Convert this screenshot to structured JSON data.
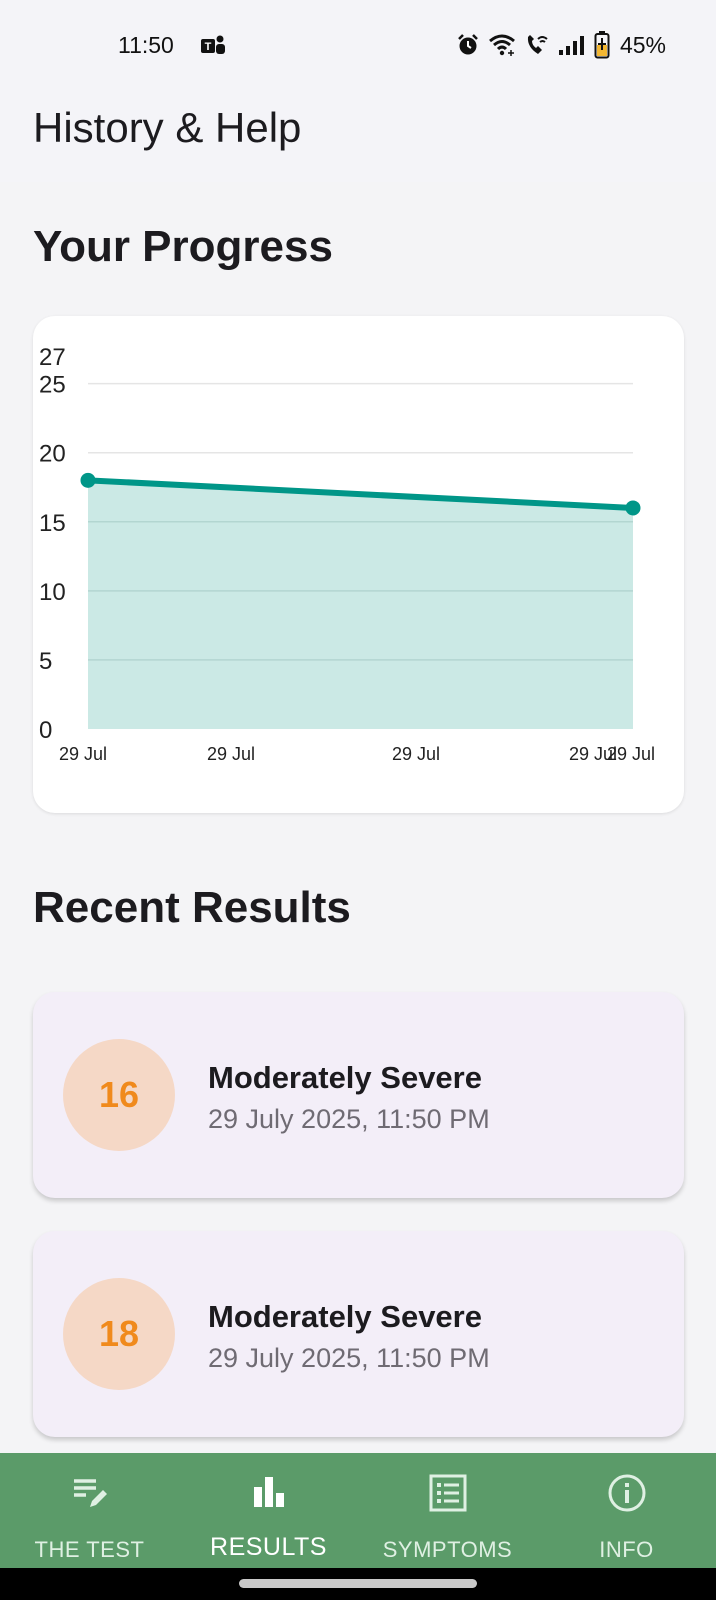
{
  "status_bar": {
    "time": "11:50",
    "battery_percent": "45%",
    "icons": [
      "teams-icon",
      "alarm-icon",
      "wifi-icon",
      "wifi-call-icon",
      "signal-icon",
      "battery-charging-icon"
    ]
  },
  "app_bar": {
    "title": "History & Help"
  },
  "progress": {
    "title": "Your Progress"
  },
  "chart_data": {
    "type": "area",
    "x": [
      "29 Jul",
      "29 Jul",
      "29 Jul",
      "29 Jul",
      "29 Jul"
    ],
    "series": [
      {
        "values": [
          18,
          16
        ]
      }
    ],
    "y_ticks": [
      "0",
      "5",
      "10",
      "15",
      "20",
      "25",
      "27"
    ],
    "ylim": [
      0,
      27
    ],
    "grid": true,
    "colors": {
      "line": "#009688",
      "fill": "#cbe9e5",
      "grid": "#e5e5e5"
    }
  },
  "recent": {
    "title": "Recent Results",
    "items": [
      {
        "score": "16",
        "label": "Moderately Severe",
        "date": "29 July 2025, 11:50 PM"
      },
      {
        "score": "18",
        "label": "Moderately Severe",
        "date": "29 July 2025, 11:50 PM"
      }
    ]
  },
  "nav": {
    "items": [
      {
        "label": "THE TEST",
        "icon": "edit-list-icon",
        "active": false
      },
      {
        "label": "RESULTS",
        "icon": "bar-chart-icon",
        "active": true
      },
      {
        "label": "SYMPTOMS",
        "icon": "checklist-icon",
        "active": false
      },
      {
        "label": "INFO",
        "icon": "info-icon",
        "active": false
      }
    ]
  },
  "colors": {
    "nav_background": "#5b9b69",
    "score_circle": "#f5d8c6",
    "score_text": "#f08a1c",
    "card_background": "#f3eef8"
  }
}
